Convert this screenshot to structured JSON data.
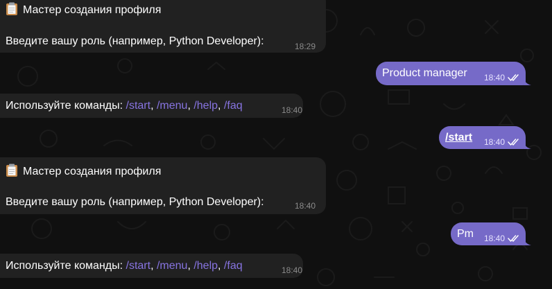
{
  "messages": [
    {
      "icon": "clipboard-icon",
      "title": "Мастер создания профиля",
      "body": "Введите вашу роль (например, Python Developer):",
      "time": "18:29"
    },
    {
      "text": "Product manager",
      "time": "18:40",
      "status": "read"
    },
    {
      "prefix": "Используйте команды: ",
      "commands": [
        "/start",
        "/menu",
        "/help",
        "/faq"
      ],
      "separator": ", ",
      "time": "18:40"
    },
    {
      "text": "/start",
      "time": "18:40",
      "status": "read"
    },
    {
      "icon": "clipboard-icon",
      "title": "Мастер создания профиля",
      "body": "Введите вашу роль (например, Python Developer):",
      "time": "18:40"
    },
    {
      "text": "Pm",
      "time": "18:40",
      "status": "read"
    },
    {
      "prefix": "Используйте команды: ",
      "commands": [
        "/start",
        "/menu",
        "/help",
        "/faq"
      ],
      "separator": ", ",
      "time": "18:40"
    }
  ],
  "colors": {
    "background": "#101010",
    "incoming_bubble": "#212121",
    "outgoing_bubble": "#766ac8",
    "command_link": "#8774e1"
  }
}
